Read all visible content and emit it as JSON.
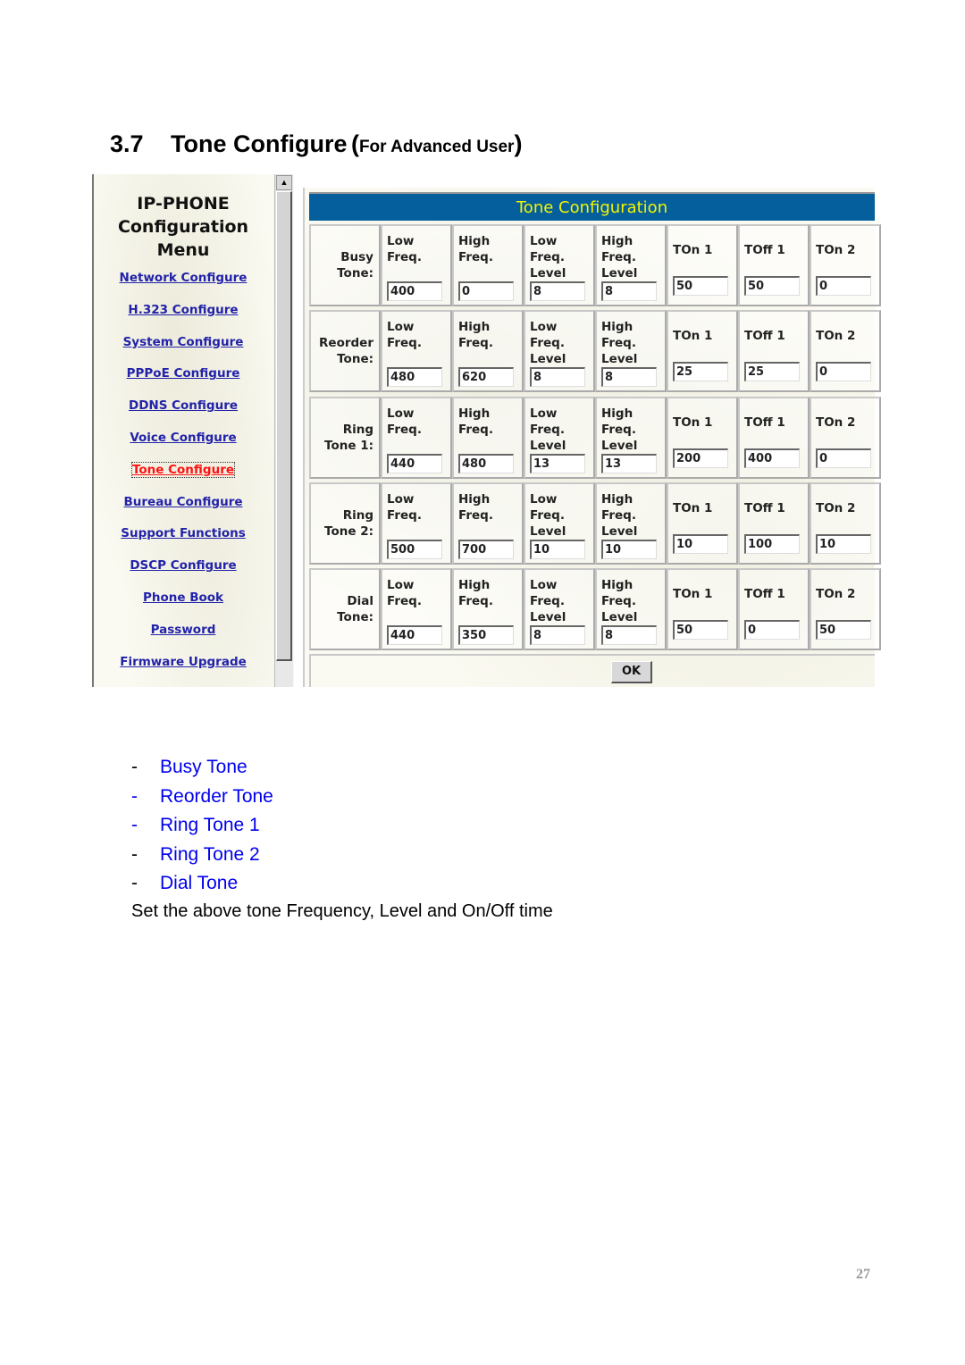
{
  "heading": {
    "number": "3.7",
    "title": "Tone Configure",
    "paren_open": "(",
    "subtitle": "For Advanced User",
    "paren_close": ")"
  },
  "menu": {
    "title_lines": [
      "IP-PHONE",
      "Configuration",
      "Menu"
    ],
    "scroll_up_icon": "▲",
    "items": [
      {
        "label": "Network Configure",
        "active": false
      },
      {
        "label": "H.323 Configure",
        "active": false
      },
      {
        "label": "System Configure",
        "active": false
      },
      {
        "label": "PPPoE Configure",
        "active": false
      },
      {
        "label": "DDNS Configure",
        "active": false
      },
      {
        "label": "Voice Configure",
        "active": false
      },
      {
        "label": "Tone Configure",
        "active": true
      },
      {
        "label": "Bureau Configure",
        "active": false
      },
      {
        "label": "Support Functions",
        "active": false
      },
      {
        "label": "DSCP Configure",
        "active": false
      },
      {
        "label": "Phone Book",
        "active": false
      },
      {
        "label": "Password",
        "active": false
      },
      {
        "label": "Firmware Upgrade",
        "active": false
      }
    ]
  },
  "tone_config": {
    "title": "Tone Configuration",
    "header_color": "#055f9c",
    "title_color": "#f4f400",
    "field_labels": {
      "low_freq": "Low\nFreq.",
      "high_freq": "High\nFreq.",
      "low_level": "Low\nFreq.\nLevel",
      "high_level": "High\nFreq.\nLevel",
      "ton1": "TOn 1",
      "toff1": "TOff 1",
      "ton2": "TOn 2"
    },
    "rows": [
      {
        "label": "Busy\nTone:",
        "low_freq": "400",
        "high_freq": "0",
        "low_level": "8",
        "high_level": "8",
        "ton1": "50",
        "toff1": "50",
        "ton2": "0"
      },
      {
        "label": "Reorder\nTone:",
        "low_freq": "480",
        "high_freq": "620",
        "low_level": "8",
        "high_level": "8",
        "ton1": "25",
        "toff1": "25",
        "ton2": "0"
      },
      {
        "label": "Ring\nTone 1:",
        "low_freq": "440",
        "high_freq": "480",
        "low_level": "13",
        "high_level": "13",
        "ton1": "200",
        "toff1": "400",
        "ton2": "0"
      },
      {
        "label": "Ring\nTone 2:",
        "low_freq": "500",
        "high_freq": "700",
        "low_level": "10",
        "high_level": "10",
        "ton1": "10",
        "toff1": "100",
        "ton2": "10"
      },
      {
        "label": "Dial\nTone:",
        "low_freq": "440",
        "high_freq": "350",
        "low_level": "8",
        "high_level": "8",
        "ton1": "50",
        "toff1": "0",
        "ton2": "50"
      }
    ],
    "ok_label": "OK"
  },
  "bullets": [
    {
      "dash": "-",
      "text": "Busy Tone",
      "dash_blue": false
    },
    {
      "dash": "-",
      "text": "Reorder Tone",
      "dash_blue": true
    },
    {
      "dash": "-",
      "text": "Ring Tone 1",
      "dash_blue": true
    },
    {
      "dash": "-",
      "text": "Ring Tone 2",
      "dash_blue": false
    },
    {
      "dash": "-",
      "text": "Dial Tone",
      "dash_blue": false
    }
  ],
  "summary": "Set the above tone Frequency, Level and On/Off time",
  "page_number": "27"
}
